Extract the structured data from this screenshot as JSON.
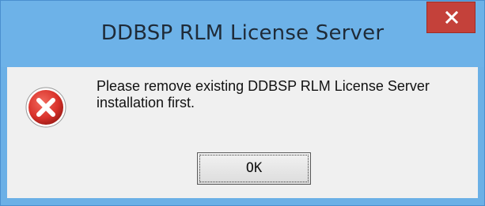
{
  "window": {
    "title": "DDBSP RLM License Server"
  },
  "dialog": {
    "message": "Please remove existing DDBSP RLM License Server installation first.",
    "icon": "error-icon",
    "ok_label": "OK"
  },
  "colors": {
    "titlebar": "#6db2e8",
    "close_button": "#c4413a",
    "client_bg": "#f0f0f0",
    "error_red": "#d9322b"
  }
}
